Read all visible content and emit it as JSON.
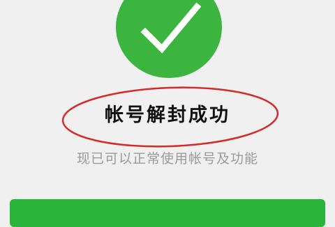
{
  "result": {
    "title": "帐号解封成功",
    "subtitle": "现已可以正常使用帐号及功能"
  },
  "icons": {
    "status_icon": "checkmark-icon"
  },
  "colors": {
    "success_green": "#3bb540",
    "annotation_red": "#d42a2a",
    "button_green": "#2ab53a",
    "subtitle_gray": "#9a9a9a"
  }
}
